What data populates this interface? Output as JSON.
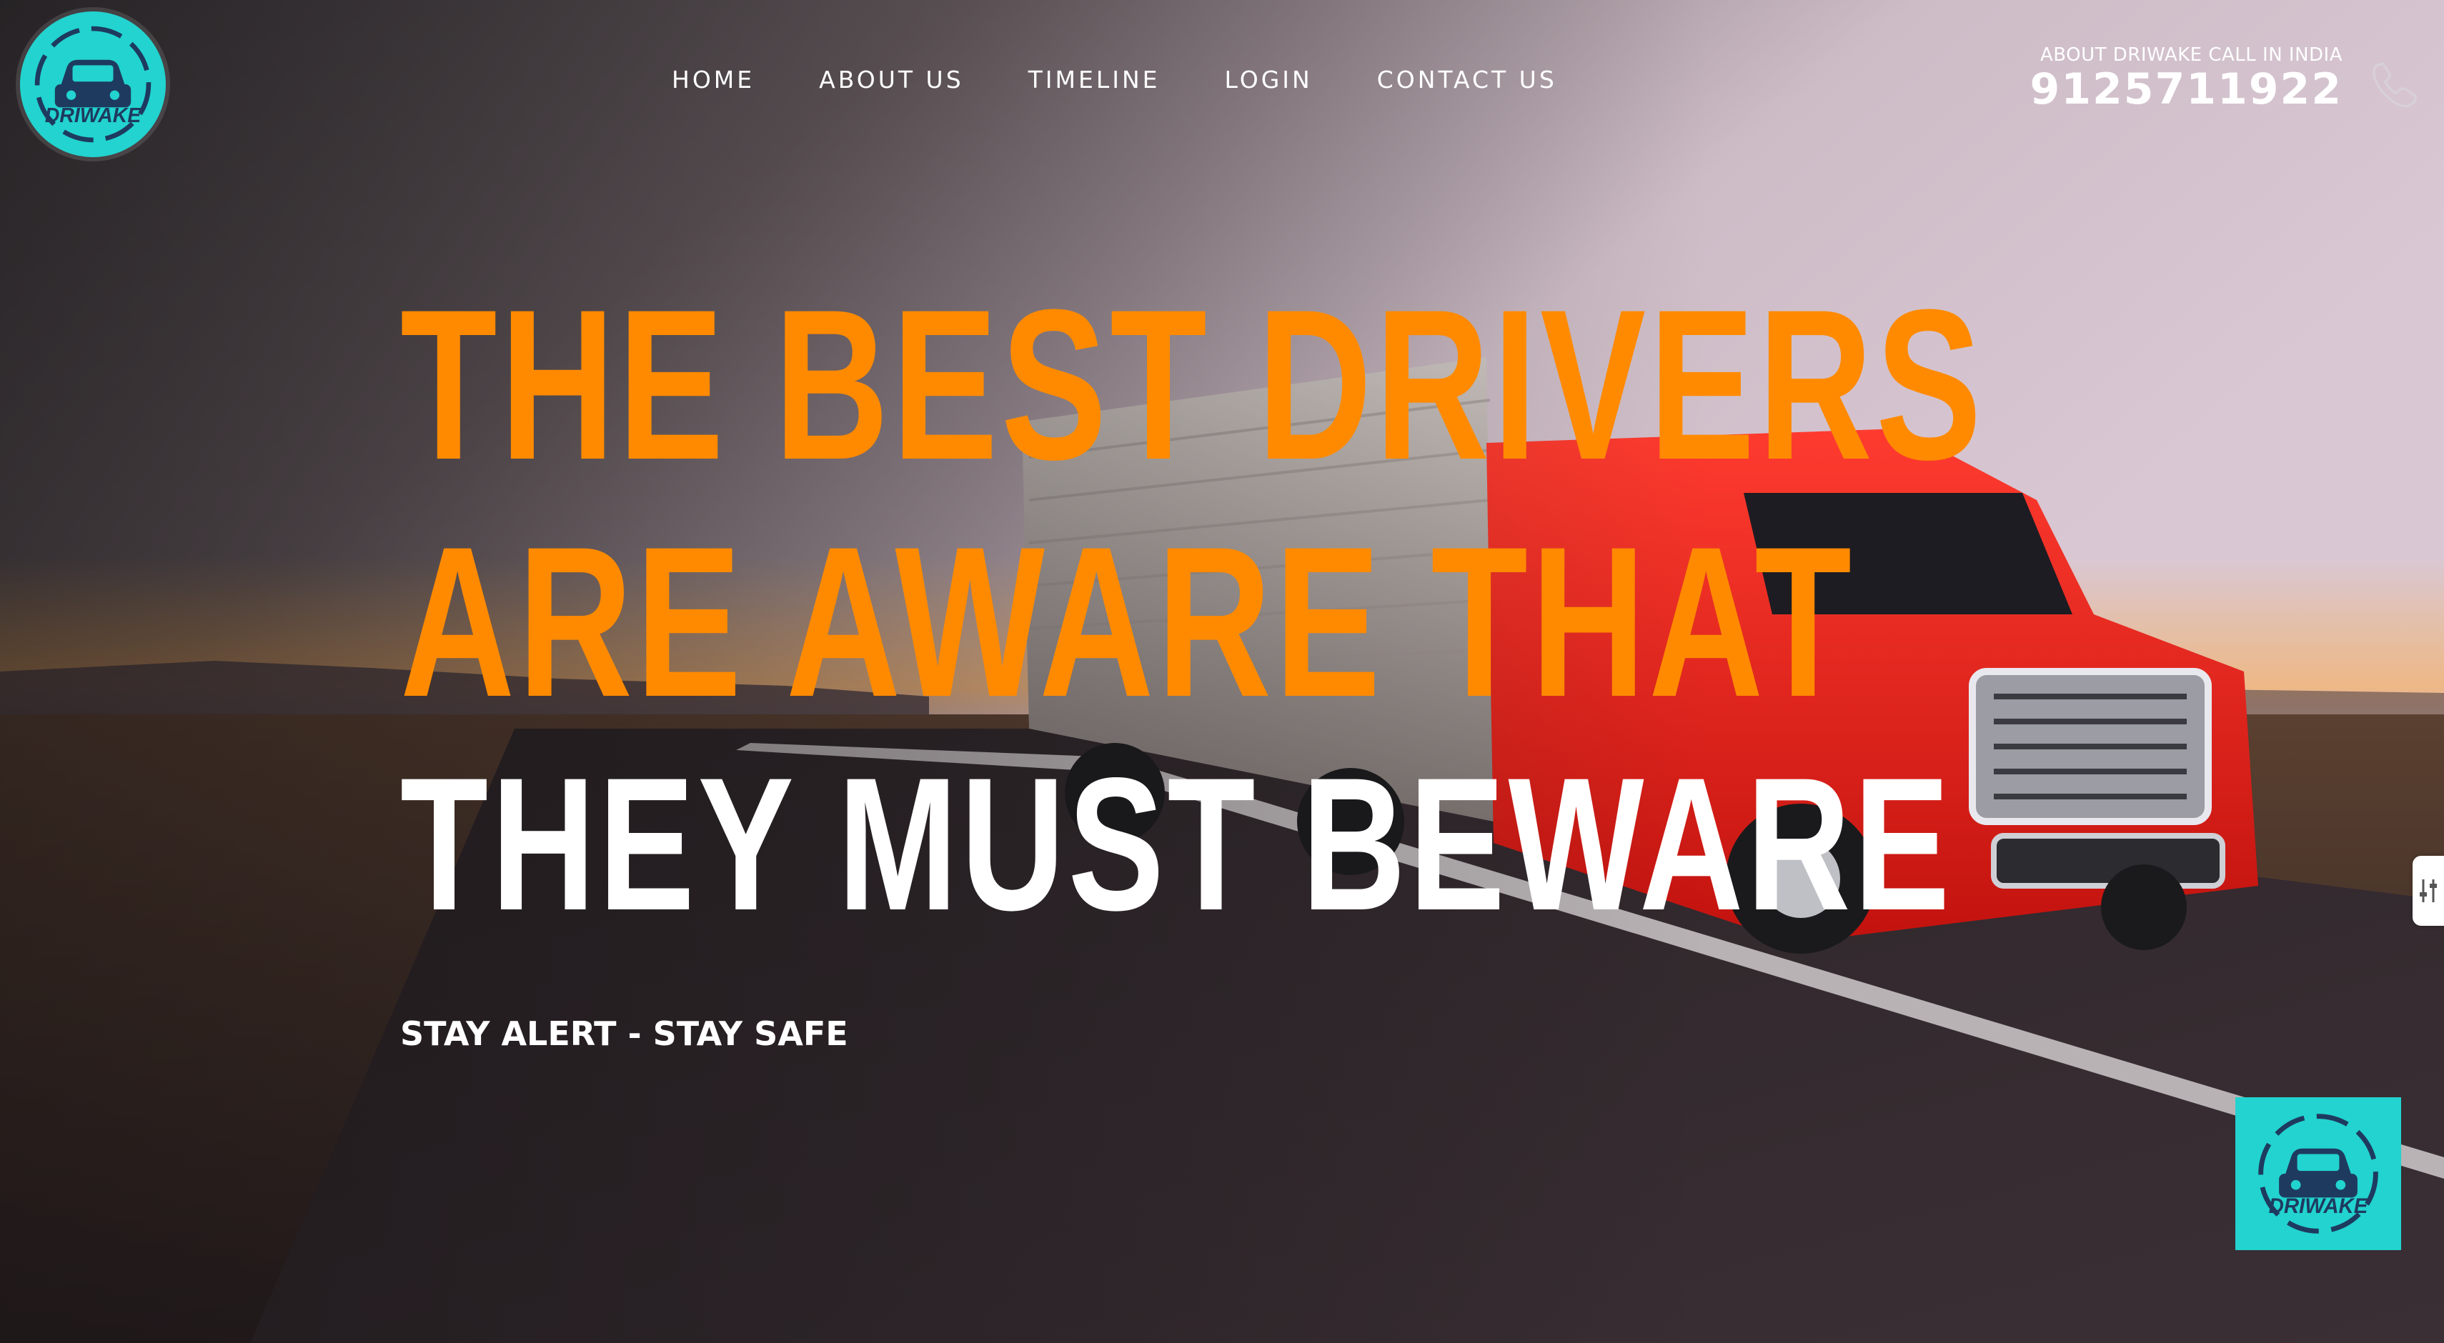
{
  "brand": {
    "name": "DRIWAKE",
    "accent": "#22d3cf",
    "logo_text": "DRIWAKE"
  },
  "nav": {
    "items": [
      {
        "label": "HOME"
      },
      {
        "label": "ABOUT US"
      },
      {
        "label": "TIMELINE"
      },
      {
        "label": "LOGIN"
      },
      {
        "label": "CONTACT US"
      }
    ]
  },
  "contact": {
    "caption": "ABOUT DRIWAKE CALL IN INDIA",
    "phone": "9125711922",
    "icon": "phone-icon"
  },
  "hero": {
    "line1": "THE BEST DRIVERS",
    "line2": "ARE AWARE THAT",
    "line3": "THEY MUST BEWARE",
    "tagline": "STAY ALERT - STAY SAFE",
    "highlight_color": "#ff8a00",
    "text_color": "#ffffff"
  },
  "widgets": {
    "side_tab_icon": "sliders-icon",
    "chat_badge_icon": "driwake-logo-icon"
  }
}
